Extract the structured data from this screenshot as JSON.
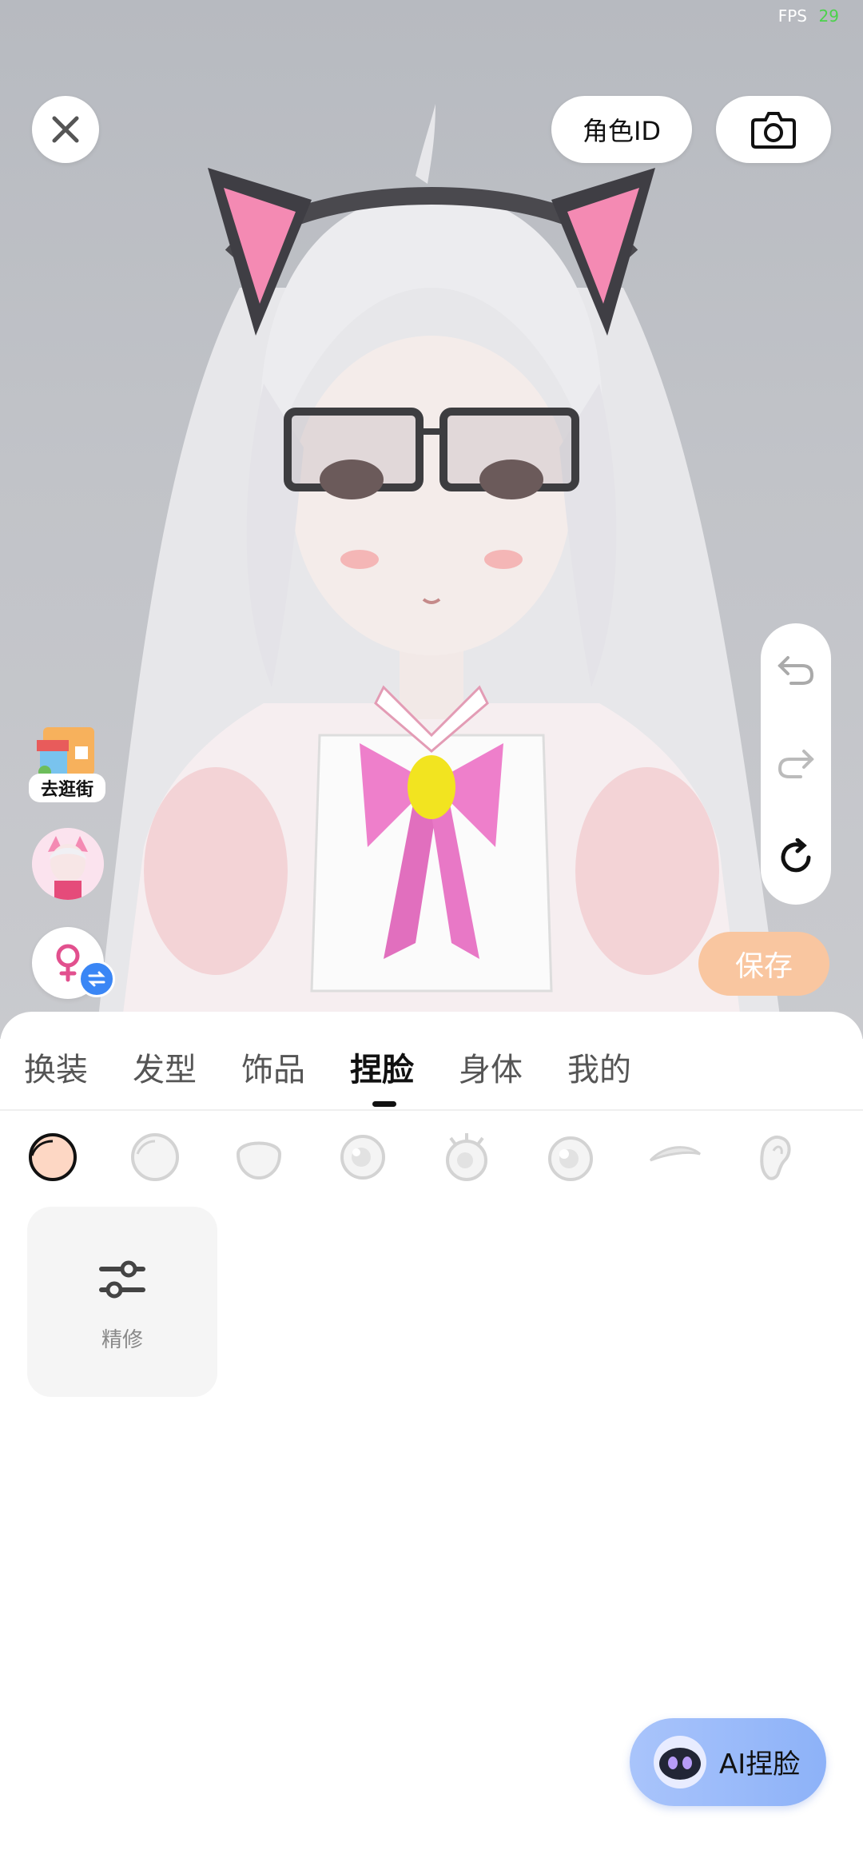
{
  "status": {
    "fps_label": "FPS",
    "fps_value": "29"
  },
  "top_bar": {
    "role_id_label": "角色ID"
  },
  "left_actions": {
    "shop_label": "去逛街"
  },
  "save_label": "保存",
  "tabs": [
    {
      "label": "换装"
    },
    {
      "label": "发型"
    },
    {
      "label": "饰品"
    },
    {
      "label": "捏脸",
      "active": true
    },
    {
      "label": "身体"
    },
    {
      "label": "我的"
    }
  ],
  "face_categories": [
    "face-shape-icon",
    "face-outline-icon",
    "face-jaw-icon",
    "eye-icon",
    "eyelash-icon",
    "eye-highlight-icon",
    "eyebrow-icon",
    "ear-icon"
  ],
  "fine_tune": {
    "label": "精修"
  },
  "ai_button": {
    "label": "AI捏脸"
  },
  "colors": {
    "accent_save": "#f9c6a0",
    "ai_gradient_start": "#a9c4fb",
    "ai_gradient_end": "#8db2f8",
    "swap_badge": "#3a86f5"
  }
}
